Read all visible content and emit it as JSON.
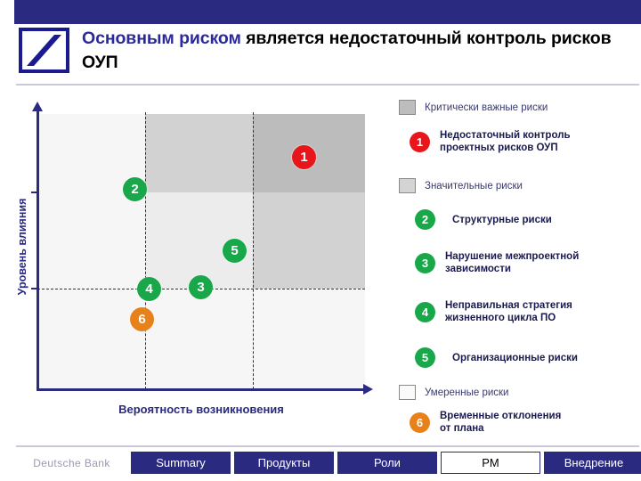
{
  "header": {
    "title_highlight": "Основным риском",
    "title_rest": " является недостаточный контроль рисков ОУП",
    "accent_color": "#2a2a80",
    "logo_name": "deutsche-bank-logo"
  },
  "chart_data": {
    "type": "scatter",
    "title": "",
    "xlabel": "Вероятность возникновения",
    "ylabel": "Уровень влияния",
    "xlim": [
      0,
      100
    ],
    "ylim": [
      0,
      100
    ],
    "grid": "dashed-quadrant",
    "x_dividers": [
      33,
      66
    ],
    "y_dividers": [
      25,
      75
    ],
    "points": [
      {
        "id": "1",
        "label": "Недостаточный контроль проектных рисков ОУП",
        "x": 82,
        "y": 88,
        "color": "#e8151a",
        "severity": "critical"
      },
      {
        "id": "2",
        "label": "Структурные риски",
        "x": 28,
        "y": 75,
        "color": "#18a849",
        "severity": "significant"
      },
      {
        "id": "3",
        "label": "Нарушение межпроектной зависимости",
        "x": 50,
        "y": 39,
        "color": "#18a849",
        "severity": "significant"
      },
      {
        "id": "4",
        "label": "Неправильная стратегия жизненного цикла ПО",
        "x": 34,
        "y": 38,
        "color": "#18a849",
        "severity": "significant"
      },
      {
        "id": "5",
        "label": "Организационные риски",
        "x": 60,
        "y": 52,
        "color": "#18a849",
        "severity": "significant"
      },
      {
        "id": "6",
        "label": "Временные отклонения от плана",
        "x": 32,
        "y": 27,
        "color": "#e8811a",
        "severity": "moderate"
      }
    ],
    "zones": [
      {
        "name": "critical",
        "color": "#bdbdbd"
      },
      {
        "name": "significant",
        "color": "#d4d4d4"
      },
      {
        "name": "moderate",
        "color": "#ececec"
      },
      {
        "name": "low",
        "color": "#f4f4f4"
      }
    ]
  },
  "legend": {
    "groups": [
      {
        "category": "Критически важные риски",
        "swatch_color": "#bdbdbd",
        "items": [
          {
            "id": "1",
            "color": "#e8151a",
            "label_line1": "Недостаточный контроль",
            "label_line2": "проектных рисков ОУП"
          }
        ]
      },
      {
        "category": "Значительные риски",
        "swatch_color": "#d4d4d4",
        "items": [
          {
            "id": "2",
            "color": "#18a849",
            "label_line1": "Структурные риски",
            "label_line2": ""
          },
          {
            "id": "3",
            "color": "#18a849",
            "label_line1": "Нарушение межпроектной",
            "label_line2": "зависимости"
          },
          {
            "id": "4",
            "color": "#18a849",
            "label_line1": "Неправильная стратегия",
            "label_line2": "жизненного цикла ПО"
          },
          {
            "id": "5",
            "color": "#18a849",
            "label_line1": "Организационные риски",
            "label_line2": ""
          }
        ]
      },
      {
        "category": "Умеренные риски",
        "swatch_color": "#fafafa",
        "items": [
          {
            "id": "6",
            "color": "#e8811a",
            "label_line1": "Временные отклонения",
            "label_line2": "от плана"
          }
        ]
      }
    ]
  },
  "navbar": {
    "brand": "Deutsche Bank",
    "tabs": [
      {
        "label": "Summary",
        "active": false,
        "width": 112
      },
      {
        "label": "Продукты",
        "active": false,
        "width": 112
      },
      {
        "label": "Роли",
        "active": false,
        "width": 112
      },
      {
        "label": "PM",
        "active": true,
        "width": 112
      },
      {
        "label": "Внедрение",
        "active": false,
        "width": 112
      }
    ]
  }
}
